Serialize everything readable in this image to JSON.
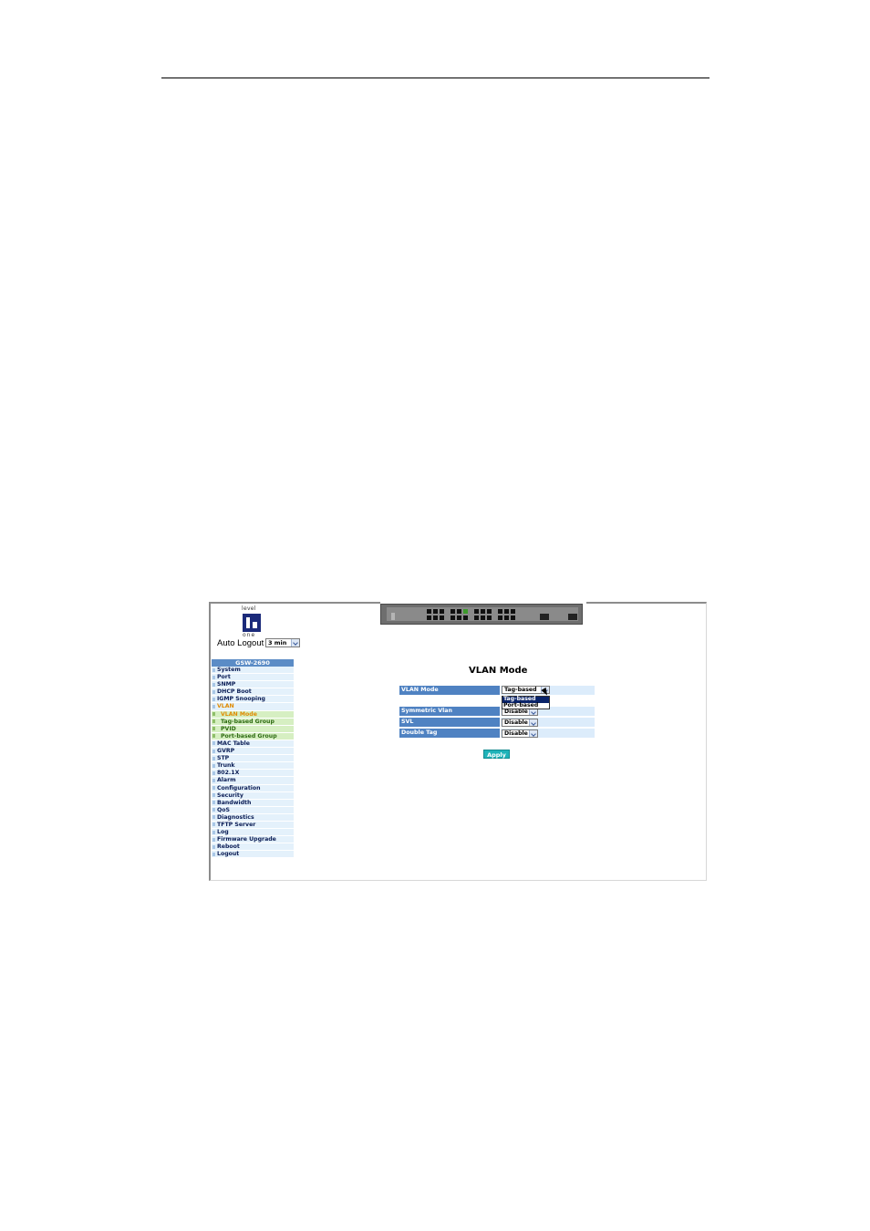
{
  "auto_logout": {
    "label": "Auto Logout",
    "value": "3 min"
  },
  "logo": {
    "top_text": "level",
    "bottom_text": "one"
  },
  "menu": {
    "header": "GSW-2690",
    "items": [
      {
        "label": "System",
        "type": "item"
      },
      {
        "label": "Port",
        "type": "item"
      },
      {
        "label": "SNMP",
        "type": "item"
      },
      {
        "label": "DHCP Boot",
        "type": "item"
      },
      {
        "label": "IGMP Snooping",
        "type": "item"
      },
      {
        "label": "VLAN",
        "type": "active"
      },
      {
        "label": "VLAN Mode",
        "type": "sub-current"
      },
      {
        "label": "Tag-based Group",
        "type": "sub"
      },
      {
        "label": "PVID",
        "type": "sub"
      },
      {
        "label": "Port-based Group",
        "type": "sub"
      },
      {
        "label": "MAC Table",
        "type": "item"
      },
      {
        "label": "GVRP",
        "type": "item"
      },
      {
        "label": "STP",
        "type": "item"
      },
      {
        "label": "Trunk",
        "type": "item"
      },
      {
        "label": "802.1X",
        "type": "item"
      },
      {
        "label": "Alarm",
        "type": "item"
      },
      {
        "label": "Configuration",
        "type": "item"
      },
      {
        "label": "Security",
        "type": "item"
      },
      {
        "label": "Bandwidth",
        "type": "item"
      },
      {
        "label": "QoS",
        "type": "item"
      },
      {
        "label": "Diagnostics",
        "type": "item"
      },
      {
        "label": "TFTP Server",
        "type": "item"
      },
      {
        "label": "Log",
        "type": "item"
      },
      {
        "label": "Firmware Upgrade",
        "type": "item"
      },
      {
        "label": "Reboot",
        "type": "item"
      },
      {
        "label": "Logout",
        "type": "item"
      }
    ]
  },
  "main": {
    "title": "VLAN Mode",
    "rows": [
      {
        "label": "VLAN Mode",
        "value": "Tag-based"
      },
      {
        "label": "Symmetric Vlan",
        "value": "Disable"
      },
      {
        "label": "SVL",
        "value": "Disable"
      },
      {
        "label": "Double Tag",
        "value": "Disable"
      }
    ],
    "dropdown_options": [
      "Tag-based",
      "Port-based"
    ],
    "apply_label": "Apply"
  },
  "colors": {
    "menu_header": "#5b8cc6",
    "row_label": "#4f82c2",
    "apply": "#1fb3b9",
    "active": "#e08a00"
  }
}
